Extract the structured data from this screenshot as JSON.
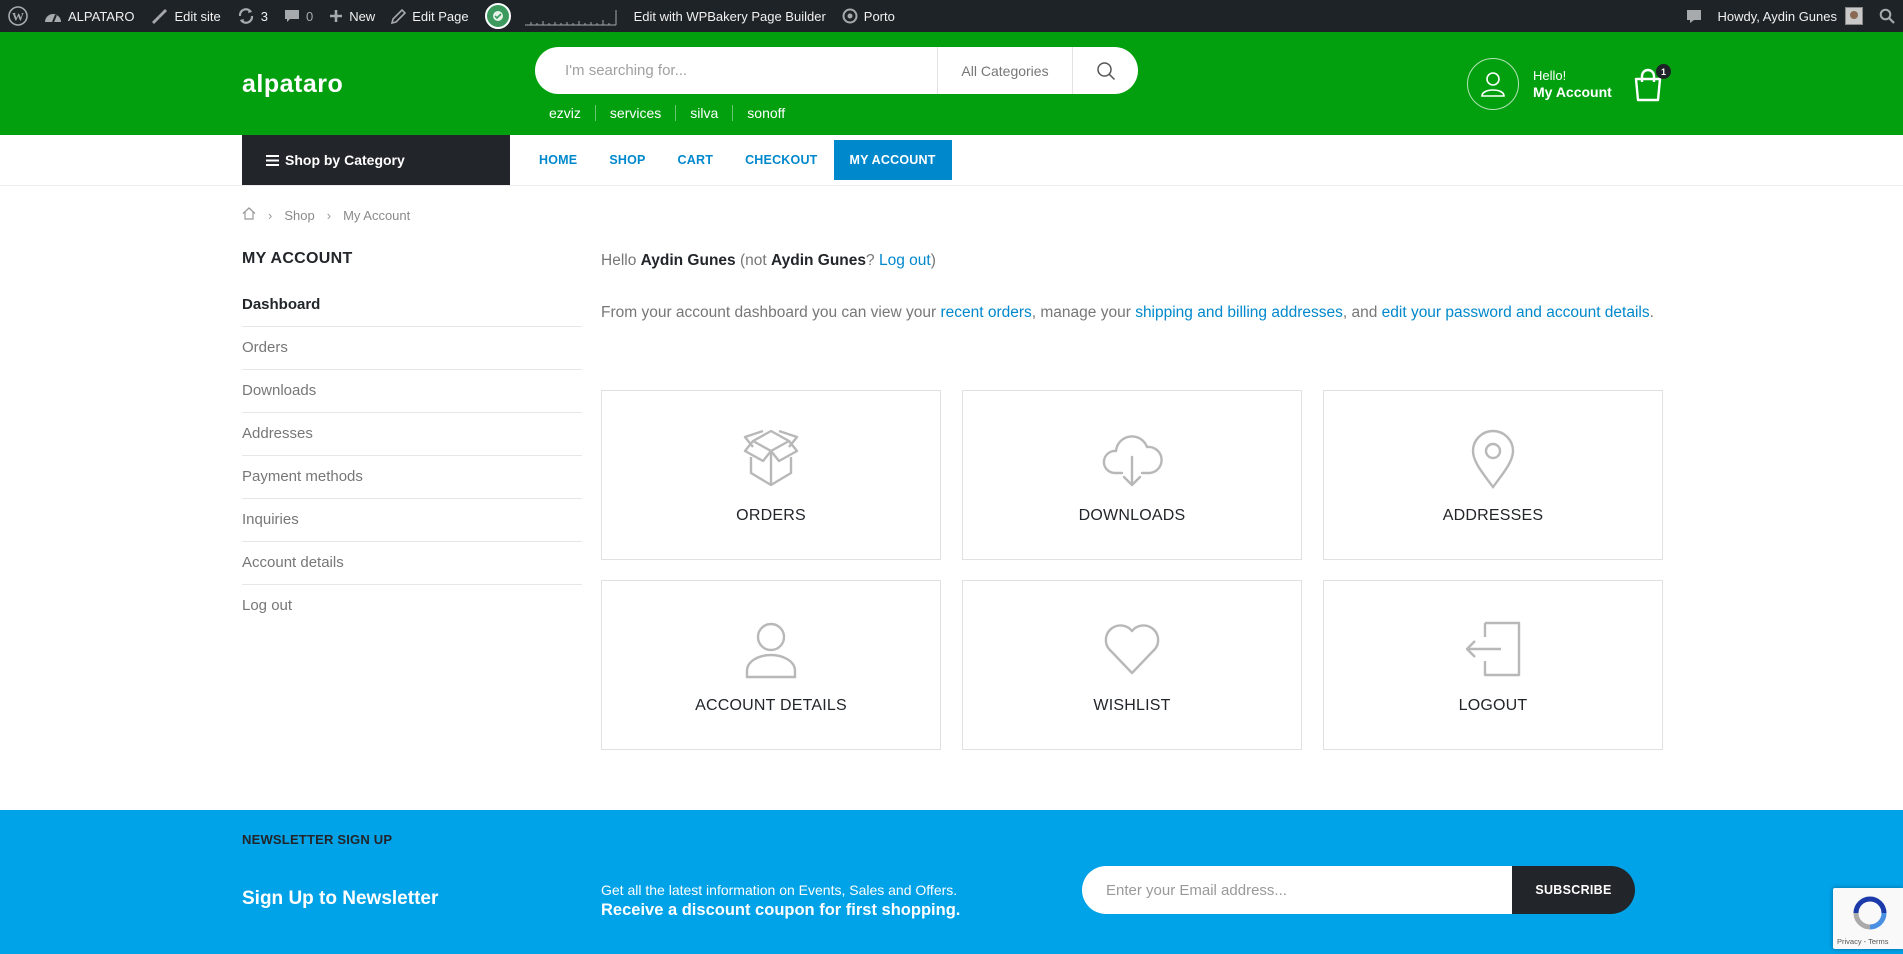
{
  "adminbar": {
    "site_name": "ALPATARO",
    "edit_site": "Edit site",
    "updates_count": "3",
    "comments_count": "0",
    "new_label": "New",
    "edit_page": "Edit Page",
    "wpbakery": "Edit with WPBakery Page Builder",
    "theme": "Porto",
    "howdy": "Howdy, Aydin Gunes"
  },
  "header": {
    "logo": "alpataro",
    "search_placeholder": "I'm searching for...",
    "search_category": "All Categories",
    "search_tags": [
      "ezviz",
      "services",
      "silva",
      "sonoff"
    ],
    "account_hello": "Hello!",
    "account_label": "My Account",
    "cart_count": "1"
  },
  "nav": {
    "shop_by_category": "Shop by Category",
    "items": [
      "HOME",
      "SHOP",
      "CART",
      "CHECKOUT",
      "MY ACCOUNT"
    ]
  },
  "breadcrumb": {
    "shop": "Shop",
    "current": "My Account"
  },
  "sidebar": {
    "title": "MY ACCOUNT",
    "items": [
      "Dashboard",
      "Orders",
      "Downloads",
      "Addresses",
      "Payment methods",
      "Inquiries",
      "Account details",
      "Log out"
    ]
  },
  "main": {
    "hello_prefix": "Hello ",
    "user": "Aydin Gunes",
    "not_prefix": " (not ",
    "user2": "Aydin Gunes",
    "question": "? ",
    "logout_link": "Log out",
    "close_paren": ")",
    "intro_1": "From your account dashboard you can view your ",
    "link_orders": "recent orders",
    "intro_2": ", manage your ",
    "link_addresses": "shipping and billing addresses",
    "intro_3": ", and ",
    "link_details": "edit your password and account details",
    "intro_4": ".",
    "cards": [
      "ORDERS",
      "DOWNLOADS",
      "ADDRESSES",
      "ACCOUNT DETAILS",
      "WISHLIST",
      "LOGOUT"
    ]
  },
  "newsletter": {
    "small_title": "NEWSLETTER SIGN UP",
    "title": "Sign Up to Newsletter",
    "info_1": "Get all the latest information on Events, Sales and Offers.",
    "info_2": "Receive a discount coupon for first shopping.",
    "email_placeholder": "Enter your Email address...",
    "subscribe": "SUBSCRIBE"
  },
  "recaptcha": {
    "text": "Privacy - Terms"
  },
  "colors": {
    "header_green": "#02a00f",
    "nav_blue": "#0088cc",
    "newsletter_blue": "#00a2e8",
    "dark": "#222529",
    "adminbar": "#1d2327"
  }
}
